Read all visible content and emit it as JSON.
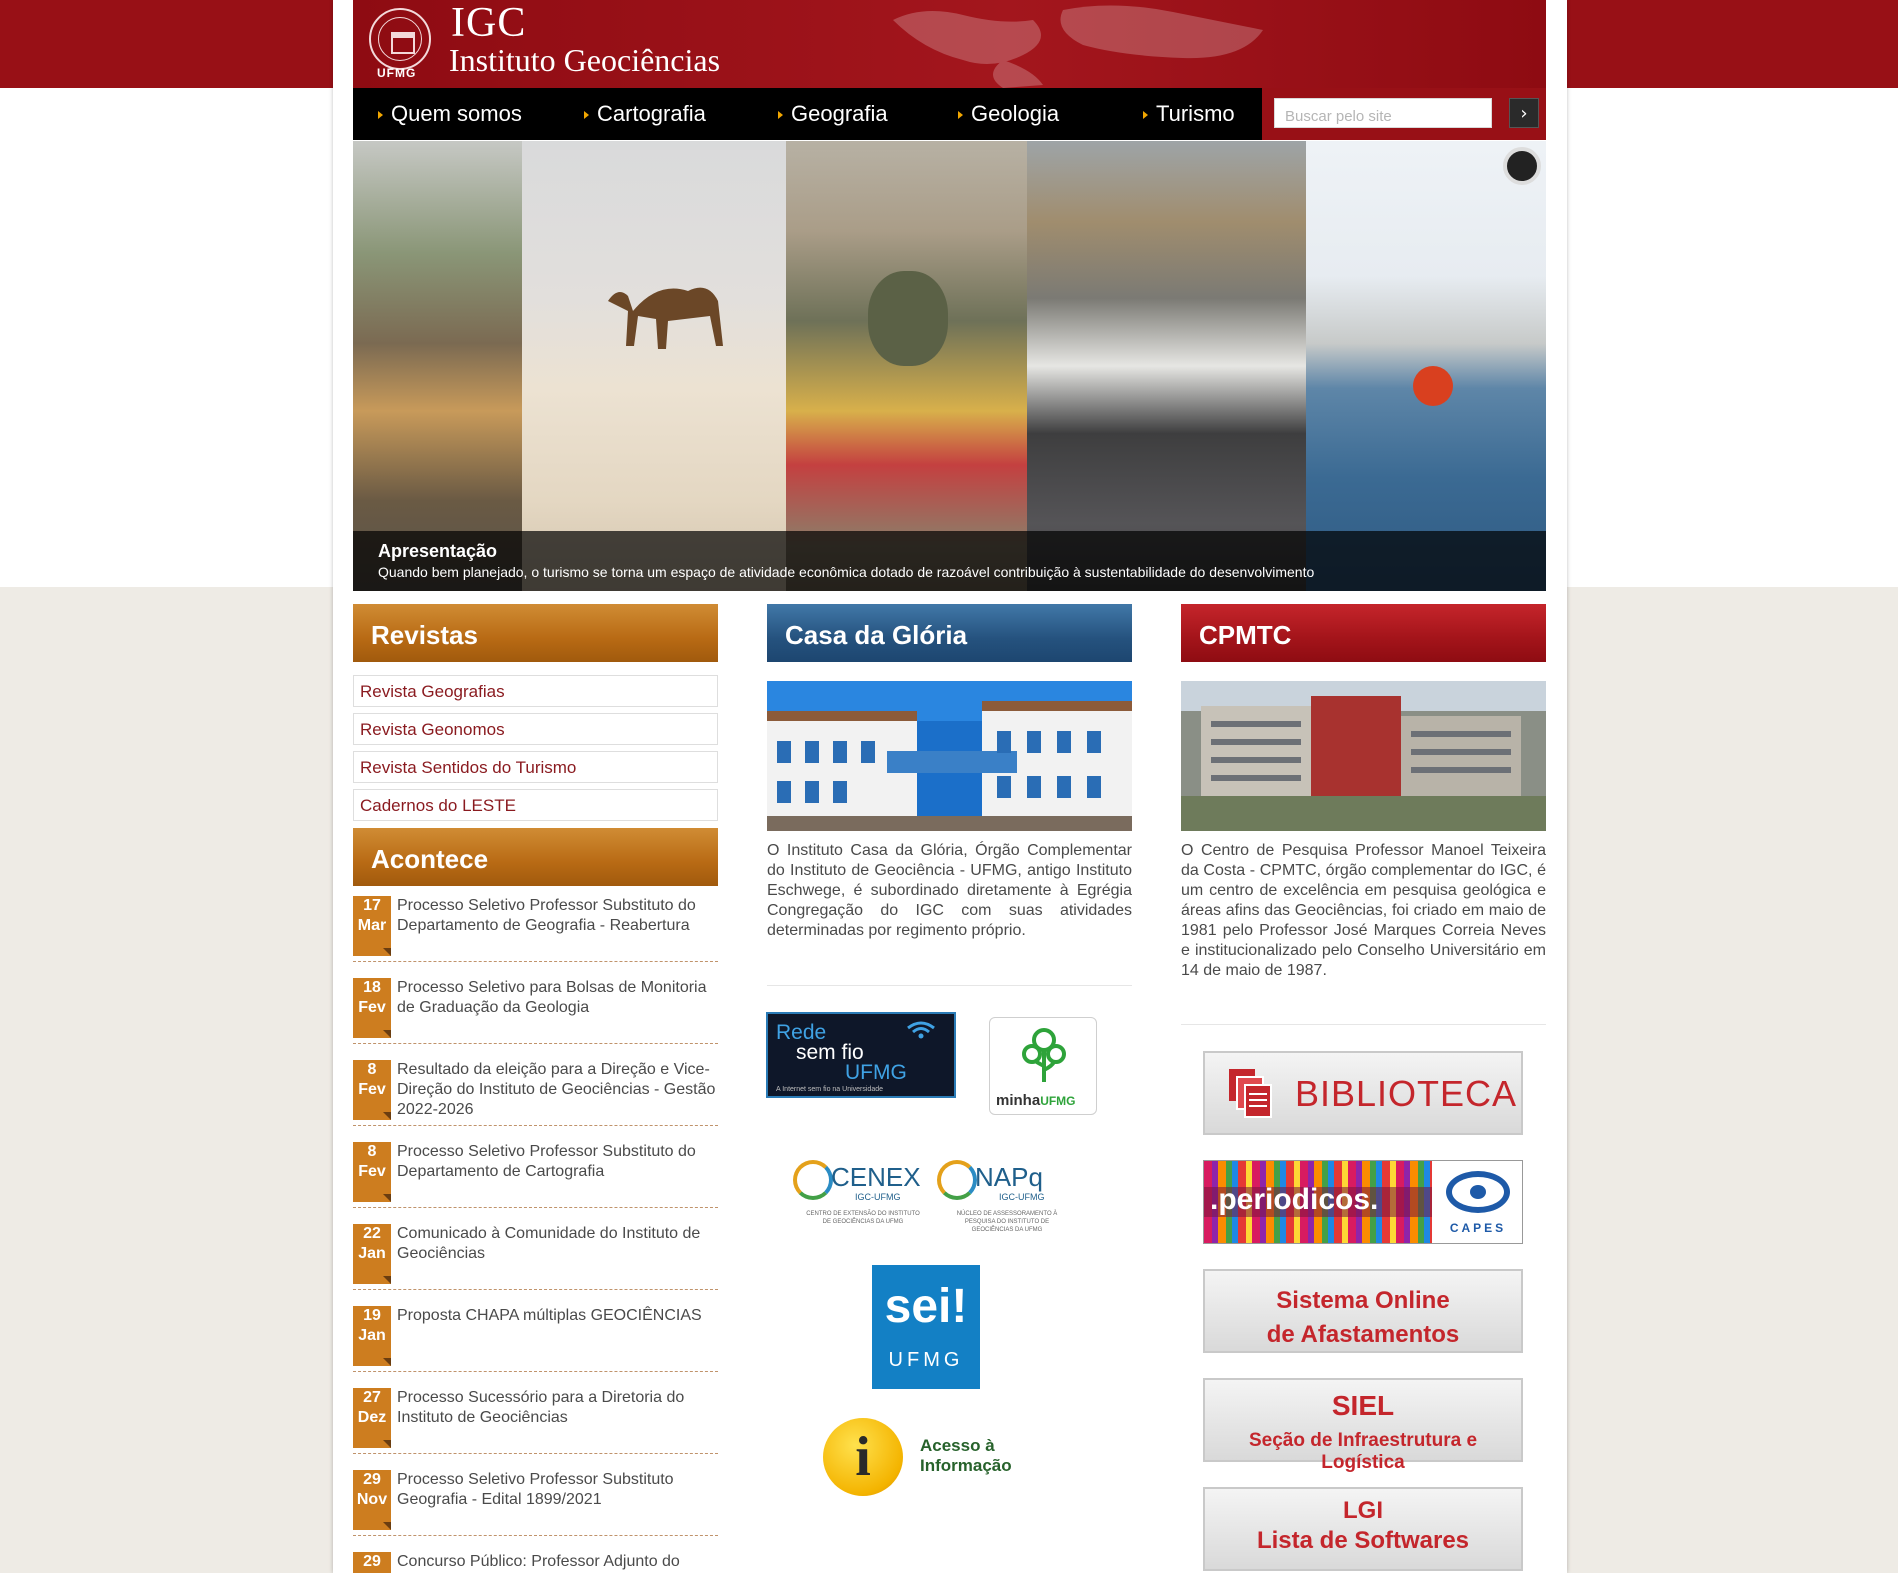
{
  "header": {
    "university": "UFMG",
    "logo_short": "IGC",
    "logo_name": "Instituto Geociências"
  },
  "nav": {
    "items": [
      {
        "label": "Quem somos"
      },
      {
        "label": "Cartografia"
      },
      {
        "label": "Geografia"
      },
      {
        "label": "Geologia"
      },
      {
        "label": "Turismo"
      }
    ],
    "search_placeholder": "Buscar pelo site",
    "search_button_icon": "chevron-right-icon"
  },
  "banner": {
    "caption_title": "Apresentação",
    "caption_text": "Quando bem planejado, o turismo se torna um espaço de atividade econômica dotado de razoável contribuição à sustentabilidade do desenvolvimento",
    "pause_icon": "pause-icon"
  },
  "revistas": {
    "title": "Revistas",
    "links": [
      {
        "label": "Revista Geografias"
      },
      {
        "label": "Revista Geonomos"
      },
      {
        "label": "Revista Sentidos do Turismo"
      },
      {
        "label": "Cadernos do LESTE"
      }
    ]
  },
  "acontece": {
    "title": "Acontece",
    "items": [
      {
        "day": "17",
        "month": "Mar",
        "text": "Processo Seletivo Professor Substituto do Departamento de Geografia - Reabertura"
      },
      {
        "day": "18",
        "month": "Fev",
        "text": "Processo Seletivo para Bolsas de Monitoria de Graduação da Geologia"
      },
      {
        "day": "8",
        "month": "Fev",
        "text": "Resultado da eleição para a Direção e Vice-Direção do Instituto de Geociências - Gestão 2022-2026"
      },
      {
        "day": "8",
        "month": "Fev",
        "text": "Processo Seletivo Professor Substituto do Departamento de Cartografia"
      },
      {
        "day": "22",
        "month": "Jan",
        "text": "Comunicado à Comunidade do Instituto de Geociências"
      },
      {
        "day": "19",
        "month": "Jan",
        "text": "Proposta CHAPA múltiplas GEOCIÊNCIAS"
      },
      {
        "day": "27",
        "month": "Dez",
        "text": "Processo Sucessório para a Diretoria do Instituto de Geociências"
      },
      {
        "day": "29",
        "month": "Nov",
        "text": "Processo Seletivo Professor Substituto Geografia - Edital 1899/2021"
      },
      {
        "day": "29",
        "month": "",
        "text": "Concurso Público: Professor Adjunto do"
      }
    ]
  },
  "casa": {
    "title": "Casa da Glória",
    "text": "O Instituto Casa da Glória, Órgão Complementar do Instituto de Geociência - UFMG, antigo Instituto Eschwege, é subordinado diretamente à Egrégia Congregação do IGC com suas atividades determinadas por regimento próprio."
  },
  "cpmtc": {
    "title": "CPMTC",
    "text": "O Centro de Pesquisa Professor Manoel Teixeira da Costa - CPMTC, órgão complementar do IGC, é um centro de excelência em pesquisa geológica e áreas afins das Geociências, foi criado em maio de 1981 pelo Professor José Marques Correia Neves e institucionalizado pelo Conselho Universitário em 14 de maio de 1987."
  },
  "logos": {
    "wifi": {
      "line1": "Rede",
      "line2": "sem fio",
      "line3": "UFMG",
      "tagline": "A Internet sem fio na Universidade"
    },
    "minha": {
      "part1": "minha",
      "part2": "UFMG"
    },
    "cenex": {
      "name": "CENEX",
      "sub": "IGC-UFMG",
      "desc": "CENTRO DE EXTENSÃO DO INSTITUTO DE GEOCIÊNCIAS DA UFMG"
    },
    "napq": {
      "name": "NAPq",
      "sub": "IGC-UFMG",
      "desc": "NÚCLEO DE ASSESSORAMENTO À PESQUISA DO INSTITUTO DE GEOCIÊNCIAS DA UFMG"
    },
    "sei": {
      "name": "sei!",
      "sub": "UFMG"
    },
    "acesso": {
      "line1": "Acesso à",
      "line2": "Informação"
    }
  },
  "services": {
    "biblioteca": "BIBLIOTECA",
    "periodicos": ".periodicos.",
    "capes": "CAPES",
    "afastamentos": {
      "line1": "Sistema Online",
      "line2": "de Afastamentos"
    },
    "siel": {
      "line1": "SIEL",
      "line2": "Seção de Infraestrutura e Logística"
    },
    "lgi": {
      "line1": "LGI",
      "line2": "Lista de Softwares"
    }
  },
  "colors": {
    "brand_red": "#981016",
    "orange": "#cd7d1f",
    "blue": "#25527e",
    "link_red": "#8a1a1f"
  }
}
